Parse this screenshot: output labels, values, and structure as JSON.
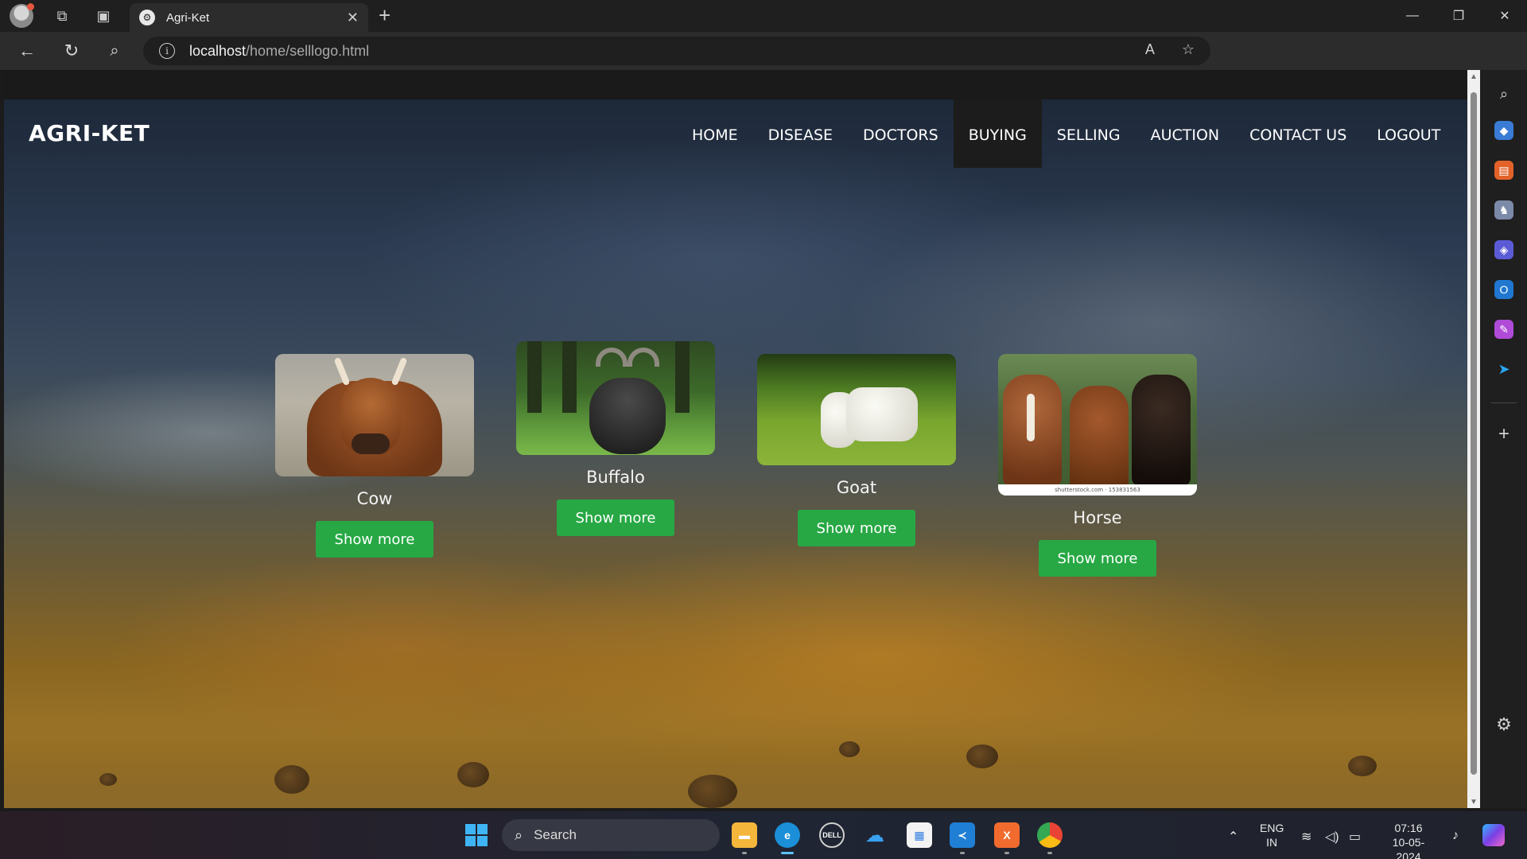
{
  "browser": {
    "tab_title": "Agri-Ket",
    "url_host": "localhost",
    "url_path": "/home/selllogo.html",
    "new_tab_symbol": "+"
  },
  "site": {
    "logo": "AGRI-KET",
    "nav": [
      {
        "label": "HOME",
        "active": false
      },
      {
        "label": "DISEASE",
        "active": false
      },
      {
        "label": "DOCTORS",
        "active": false
      },
      {
        "label": "BUYING",
        "active": true
      },
      {
        "label": "SELLING",
        "active": false
      },
      {
        "label": "AUCTION",
        "active": false
      },
      {
        "label": "CONTACT US",
        "active": false
      },
      {
        "label": "LOGOUT",
        "active": false
      }
    ]
  },
  "cards": [
    {
      "title": "Cow",
      "button": "Show more"
    },
    {
      "title": "Buffalo",
      "button": "Show more"
    },
    {
      "title": "Goat",
      "button": "Show more"
    },
    {
      "title": "Horse",
      "button": "Show more",
      "image_watermark": "shutterstock.com · 153831563"
    }
  ],
  "taskbar": {
    "search_label": "Search",
    "language": "ENG",
    "region": "IN",
    "time": "07:16",
    "date": "10-05-2024"
  },
  "colors": {
    "button_green": "#27a844",
    "active_nav_bg": "#1c1c1c"
  }
}
